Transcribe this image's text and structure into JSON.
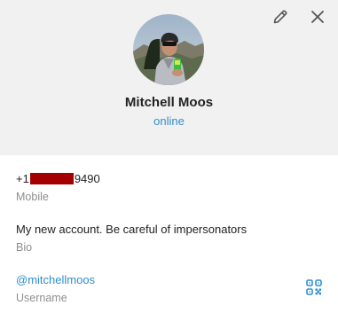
{
  "profile": {
    "name": "Mitchell Moos",
    "status": "online"
  },
  "phone": {
    "prefix": "+1",
    "suffix": "9490",
    "label": "Mobile"
  },
  "bio": {
    "text": "My new account. Be careful of impersonators",
    "label": "Bio"
  },
  "username": {
    "handle": "@mitchellmoos",
    "label": "Username"
  },
  "icons": {
    "edit": "pencil-icon",
    "close": "close-icon",
    "qr": "qr-code-icon"
  },
  "colors": {
    "accent": "#2f8fce",
    "header_bg": "#f1f1f1",
    "redaction": "#a50000"
  }
}
